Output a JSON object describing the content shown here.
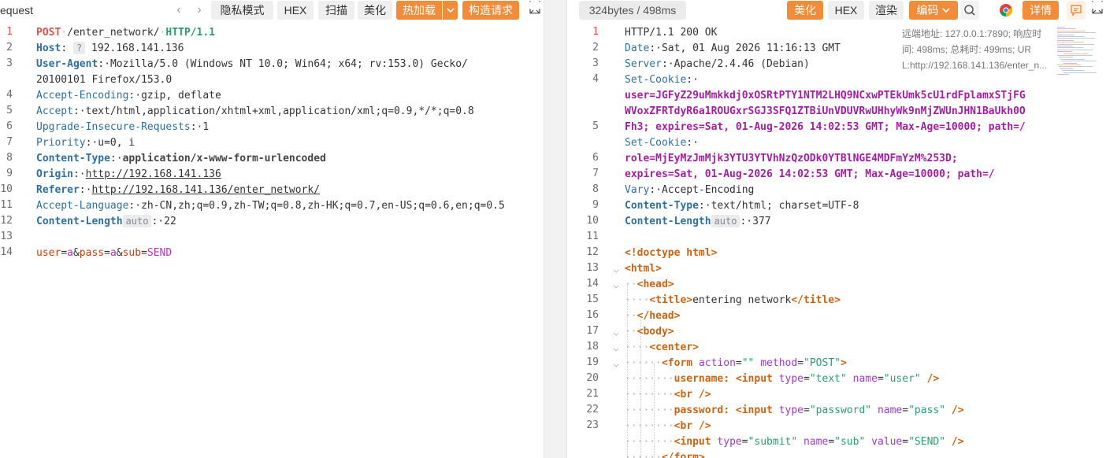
{
  "left": {
    "title": "equest",
    "buttons": {
      "privacy": "隐私模式",
      "hex": "HEX",
      "scan": "扫描",
      "beautify": "美化",
      "hotload": "热加载",
      "construct": "构造请求"
    },
    "lines": [
      {
        "n": "1"
      },
      {
        "n": "2"
      },
      {
        "n": "3"
      },
      {
        "n": ""
      },
      {
        "n": "4"
      },
      {
        "n": "5"
      },
      {
        "n": "6"
      },
      {
        "n": "7"
      },
      {
        "n": "8"
      },
      {
        "n": "9"
      },
      {
        "n": "10"
      },
      {
        "n": "11"
      },
      {
        "n": "12"
      },
      {
        "n": "13"
      },
      {
        "n": "14"
      }
    ],
    "request": {
      "method": "POST",
      "path": "/enter_network/",
      "proto": "HTTP/1.1",
      "host_key": "Host",
      "host_badge": "?",
      "host_val": "192.168.141.136",
      "ua_key": "User-Agent",
      "ua_val1": "Mozilla/5.0 (Windows NT 10.0; Win64; x64; rv:153.0) Gecko/",
      "ua_val2": "20100101 Firefox/153.0",
      "ae_key": "Accept-Encoding",
      "ae_val": "gzip, deflate",
      "accept_key": "Accept",
      "accept_val": "text/html,application/xhtml+xml,application/xml;q=0.9,*/*;q=0.8",
      "uir_key_a": "Upgrade-In",
      "uir_key_b": "secure-Requests",
      "uir_val": "1",
      "prio_key": "Priority",
      "prio_val": "u=0, i",
      "ct_key": "Content-Type",
      "ct_val": "application/x-www-form-urlencoded",
      "origin_key": "Origin",
      "origin_val": "http://192.168.141.136",
      "ref_key": "Referer",
      "ref_val": "http://192.168.141.136/enter_network/",
      "al_key": "Accept-Language",
      "al_val": "zh-CN,zh;q=0.9,zh-TW;q=0.8,zh-HK;q=0.7,en-US;q=0.6,en;q=0.5",
      "cl_key": "Content-Length",
      "cl_badge": "auto",
      "cl_val": "22",
      "body_user": "user",
      "body_userval": "a",
      "body_pass": "pass",
      "body_passval": "a",
      "body_sub": "sub",
      "body_subval": "SEND"
    }
  },
  "right": {
    "size_chip": "324bytes / 498ms",
    "buttons": {
      "beautify": "美化",
      "hex": "HEX",
      "render": "渲染",
      "encoding": "编码",
      "details": "详情"
    },
    "info": {
      "line1": "远端地址: 127.0.0.1:7890; 响应时",
      "line2": "间: 498ms; 总耗时: 499ms; UR",
      "line3": "L:http://192.168.141.136/enter_n..."
    },
    "response": {
      "status": "HTTP/1.1 200 OK",
      "date_key": "Date",
      "date_val": "Sat, 01 Aug 2026 11:16:13 GMT",
      "server_key": "Server",
      "server_val": "Apache/2.4.46 (Debian)",
      "sc_key": "Set-Cookie",
      "c1_a": "user=JGFyZ29uMmkkdj0xOSRtPTY1NTM2LHQ9NCxwPTEkUmk5cU1rdFplamxSTjFG",
      "c1_b": "WVoxZFRTdyR6a1ROUGxrSGJ3SFQ1ZTBiUnVDUVRwUHhyWk9nMjZWUnJHN1BaUkh0O",
      "c1_c": "Fh3; expires=Sat, 01-Aug-2026 14:02:53 GMT; Max-Age=10000; path=/",
      "c2_a": "role=MjEyMzJmMjk3YTU3YTVhNzQzODk0YTBlNGE4MDFmYzM%253D;",
      "c2_b": "expires=Sat, 01-Aug-2026 14:02:53 GMT; Max-Age=10000; path=/",
      "vary_key": "Vary",
      "vary_val": "Accept-Encoding",
      "ct_key": "Content-Type",
      "ct_val": "text/html; charset=UTF-8",
      "cl_key": "Content-Length",
      "cl_badge": "auto",
      "cl_val": "377",
      "doctype": "<!doctype html>",
      "html_open": "<html>",
      "head_open": "<head>",
      "title_open": "<title>",
      "title_text": "entering network",
      "title_close": "</title>",
      "head_close": "</head>",
      "body_open": "<body>",
      "center_open": "<center>",
      "form_tag": "<form",
      "form_a1": "action",
      "form_v1": "\"\"",
      "form_a2": "method",
      "form_v2": "\"POST\"",
      "username_label": "username:",
      "input_tag": "<input",
      "type_attr": "type",
      "text_val": "\"text\"",
      "name_attr": "name",
      "user_val": "\"user\"",
      "self_close": "/>",
      "br": "<br />",
      "password_label": "password:",
      "password_val": "\"password\"",
      "pass_val": "\"pass\"",
      "submit_val": "\"submit\"",
      "sub_val": "\"sub\"",
      "value_attr": "value",
      "send_val": "\"SEND\"",
      "form_close": "</form>"
    },
    "line_numbers": [
      "1",
      "2",
      "3",
      "4",
      "",
      "",
      "5",
      "",
      "6",
      "7",
      "8",
      "9",
      "10",
      "11",
      "12",
      "13",
      "14",
      "15",
      "16",
      "17",
      "18",
      "19",
      "20",
      "21",
      "22",
      "23"
    ]
  },
  "colors": {
    "accent_orange": "#f08c3a",
    "active_line_number": "#e0504a",
    "header_key": "#2f6f9e",
    "cookie_value": "#a020a0"
  }
}
